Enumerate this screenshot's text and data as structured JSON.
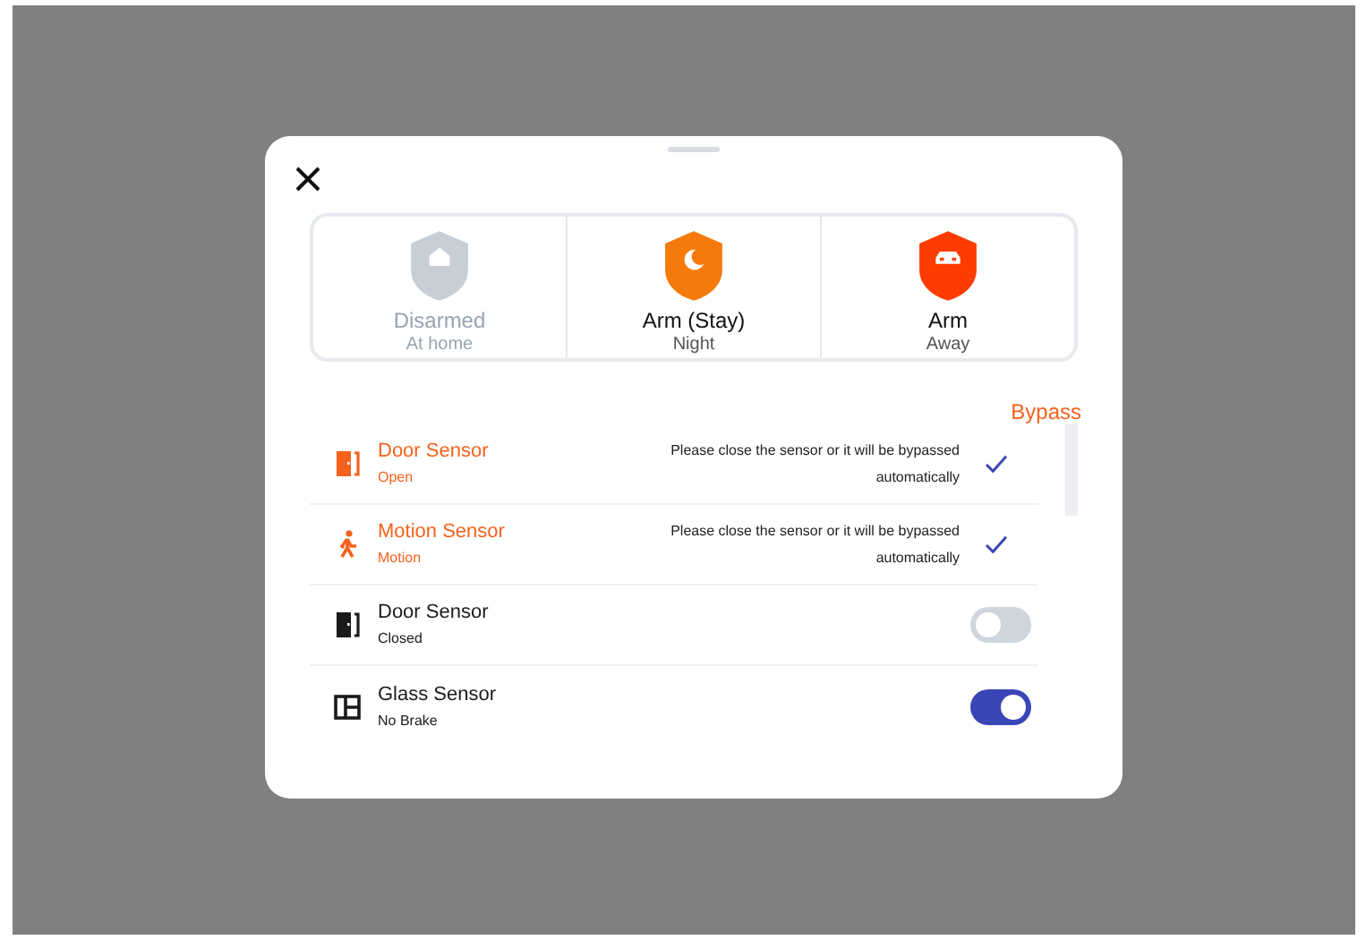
{
  "modes": [
    {
      "kind": "disarmed",
      "label": "Disarmed",
      "sublabel": "At home"
    },
    {
      "kind": "stay",
      "label": "Arm (Stay)",
      "sublabel": "Night"
    },
    {
      "kind": "away",
      "label": "Arm",
      "sublabel": "Away"
    }
  ],
  "bypass_header": "Bypass",
  "sensors": [
    {
      "kind": "door",
      "name": "Door Sensor",
      "status": "Open",
      "message": "Please close the sensor or it will be bypassed automatically",
      "checked": true
    },
    {
      "kind": "motion",
      "name": "Motion Sensor",
      "status": "Motion",
      "message": "Please close the sensor or it will be bypassed automatically",
      "checked": true
    },
    {
      "kind": "door",
      "name": "Door Sensor",
      "status": "Closed",
      "on": false
    },
    {
      "kind": "glass",
      "name": "Glass Sensor",
      "status": "No Brake",
      "on": true
    }
  ]
}
